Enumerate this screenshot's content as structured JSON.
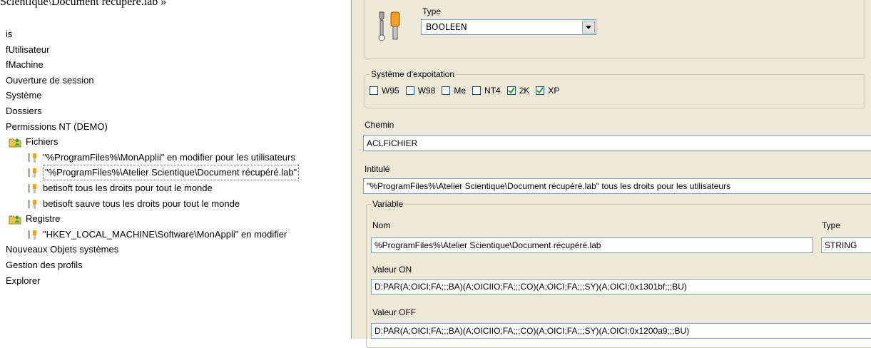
{
  "top_title": "Scientique\\Document récupéré.lab »",
  "tree": [
    {
      "label": "is",
      "indent": 0,
      "icon": "none"
    },
    {
      "label": "fUtilisateur",
      "indent": 0,
      "icon": "none"
    },
    {
      "label": "fMachine",
      "indent": 0,
      "icon": "none"
    },
    {
      "label": "Ouverture de session",
      "indent": 0,
      "icon": "none"
    },
    {
      "label": "Système",
      "indent": 0,
      "icon": "none"
    },
    {
      "label": "Dossiers",
      "indent": 0,
      "icon": "none"
    },
    {
      "label": "Permissions NT (DEMO)",
      "indent": 0,
      "icon": "none"
    },
    {
      "label": "Fichiers",
      "indent": 1,
      "icon": "folder-people"
    },
    {
      "label": "\"%ProgramFiles%\\MonApplii\" en modifier pour les utilisateurs",
      "indent": 2,
      "icon": "tools"
    },
    {
      "label": "\"%ProgramFiles%\\Atelier Scientique\\Document récupéré.lab\"",
      "indent": 2,
      "icon": "tools",
      "selected": true
    },
    {
      "label": "betisoft tous les droits pour tout le monde",
      "indent": 2,
      "icon": "tools"
    },
    {
      "label": "betisoft sauve tous les droits pour tout le monde",
      "indent": 2,
      "icon": "tools"
    },
    {
      "label": "Registre",
      "indent": 1,
      "icon": "folder-people"
    },
    {
      "label": "\"HKEY_LOCAL_MACHINE\\Software\\MonAppli\" en modifier",
      "indent": 2,
      "icon": "tools"
    },
    {
      "label": "Nouveaux Objets systèmes",
      "indent": 0,
      "icon": "none"
    },
    {
      "label": "Gestion des profils",
      "indent": 0,
      "icon": "none"
    },
    {
      "label": "Explorer",
      "indent": 0,
      "icon": "none"
    }
  ],
  "panel": {
    "type_label": "Type",
    "type_value": "BOOLEEN",
    "os_group": "Système d'expoitation",
    "os_options": [
      {
        "label": "W95",
        "checked": false
      },
      {
        "label": "W98",
        "checked": false
      },
      {
        "label": "Me",
        "checked": false
      },
      {
        "label": "NT4",
        "checked": false
      },
      {
        "label": "2K",
        "checked": true
      },
      {
        "label": "XP",
        "checked": true
      }
    ],
    "chemin_label": "Chemin",
    "chemin_value": "ACLFICHIER",
    "intitule_label": "Intitulé",
    "intitule_value": "\"%ProgramFiles%\\Atelier Scientique\\Document récupéré.lab\" tous les droits pour les utilisateurs",
    "variable_group": "Variable",
    "nom_label": "Nom",
    "nom_value": "%ProgramFiles%\\Atelier Scientique\\Document récupéré.lab",
    "var_type_label": "Type",
    "var_type_value": "STRING",
    "valeur_on_label": "Valeur ON",
    "valeur_on_value": "D:PAR(A;OICI;FA;;;BA)(A;OICIIO;FA;;;CO)(A;OICI;FA;;;SY)(A;OICI;0x1301bf;;;BU)",
    "valeur_off_label": "Valeur OFF",
    "valeur_off_value": "D:PAR(A;OICI;FA;;;BA)(A;OICIIO;FA;;;CO)(A;OICI;FA;;;SY)(A;OICI;0x1200a9;;;BU)"
  },
  "colors": {
    "panel_bg": "#ece9d8",
    "field_border": "#7f9db9",
    "checkbox_border": "#1c5180",
    "check_green": "#21a121"
  }
}
